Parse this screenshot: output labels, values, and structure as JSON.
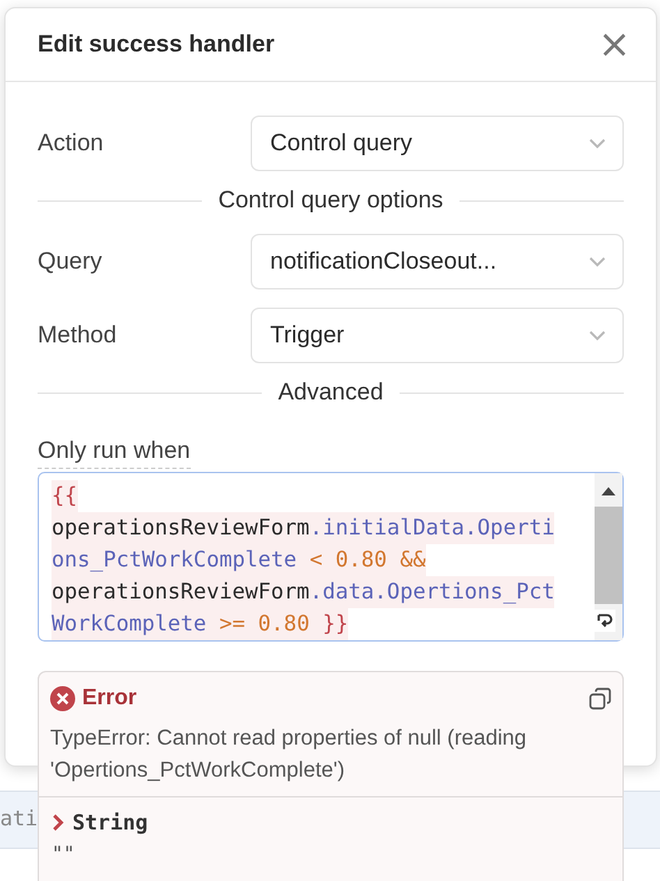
{
  "background": {
    "fragment": "ati"
  },
  "dialog": {
    "title": "Edit success handler",
    "close": "×",
    "fields": [
      {
        "kind": "select",
        "label": "Action",
        "value": "Control query"
      },
      {
        "kind": "section",
        "label": "Control query options"
      },
      {
        "kind": "select",
        "label": "Query",
        "value": "notificationCloseout..."
      },
      {
        "kind": "select",
        "label": "Method",
        "value": "Trigger"
      },
      {
        "kind": "section",
        "label": "Advanced"
      }
    ],
    "condition": {
      "label": "Only run when",
      "lines": [
        [
          {
            "text": "{{",
            "kind": "brace"
          }
        ],
        [
          {
            "text": "operationsReviewForm",
            "kind": "ident"
          },
          {
            "text": ".initialData.Operti",
            "kind": "prop"
          }
        ],
        [
          {
            "text": "ons_PctWorkComplete",
            "kind": "prop"
          },
          {
            "text": " < 0.80 &&",
            "kind": "op"
          }
        ],
        [
          {
            "text": "operationsReviewForm",
            "kind": "ident"
          },
          {
            "text": ".data.Opertions_Pct",
            "kind": "prop"
          }
        ],
        [
          {
            "text": "WorkComplete",
            "kind": "prop"
          },
          {
            "text": " >= 0.80",
            "kind": "op"
          },
          {
            "text": " }}",
            "kind": "brace"
          }
        ]
      ]
    }
  },
  "error": {
    "title": "Error",
    "message": "TypeError: Cannot read properties of null (reading 'Opertions_PctWorkComplete')",
    "type": "String",
    "value": "\"\""
  }
}
